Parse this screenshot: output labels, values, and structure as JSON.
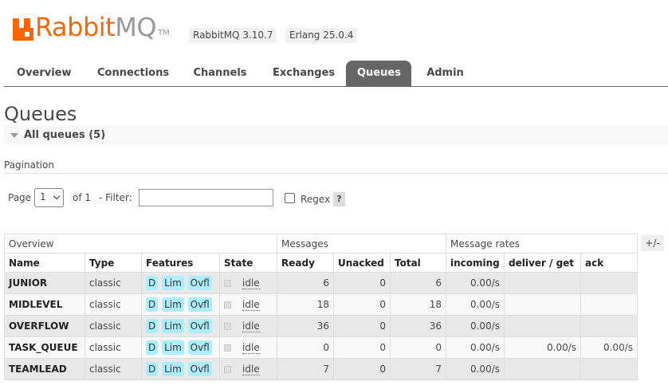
{
  "header": {
    "logo_rabbit": "Rabbit",
    "logo_mq": "MQ",
    "logo_tm": "TM",
    "version_rabbitmq": "RabbitMQ 3.10.7",
    "version_erlang": "Erlang 25.0.4",
    "brand_color": "#ff6600"
  },
  "tabs": [
    {
      "label": "Overview",
      "active": false
    },
    {
      "label": "Connections",
      "active": false
    },
    {
      "label": "Channels",
      "active": false
    },
    {
      "label": "Exchanges",
      "active": false
    },
    {
      "label": "Queues",
      "active": true
    },
    {
      "label": "Admin",
      "active": false
    }
  ],
  "page": {
    "title": "Queues",
    "section": "All queues (5)",
    "pagination_label": "Pagination",
    "page_label": "Page",
    "page_value": "1",
    "page_of": "of 1",
    "filter_label": "- Filter:",
    "filter_value": "",
    "regex_label": "Regex",
    "regex_checked": false,
    "help": "?",
    "plus_minus": "+/-"
  },
  "table": {
    "groups": [
      "Overview",
      "Messages",
      "Message rates"
    ],
    "columns": [
      "Name",
      "Type",
      "Features",
      "State",
      "Ready",
      "Unacked",
      "Total",
      "incoming",
      "deliver / get",
      "ack"
    ],
    "rows": [
      {
        "name": "JUNIOR",
        "type": "classic",
        "features": [
          "D",
          "Lim",
          "Ovfl"
        ],
        "state": "idle",
        "ready": "6",
        "unacked": "0",
        "total": "6",
        "incoming": "0.00/s",
        "deliver_get": "",
        "ack": ""
      },
      {
        "name": "MIDLEVEL",
        "type": "classic",
        "features": [
          "D",
          "Lim",
          "Ovfl"
        ],
        "state": "idle",
        "ready": "18",
        "unacked": "0",
        "total": "18",
        "incoming": "0.00/s",
        "deliver_get": "",
        "ack": ""
      },
      {
        "name": "OVERFLOW",
        "type": "classic",
        "features": [
          "D",
          "Lim",
          "Ovfl"
        ],
        "state": "idle",
        "ready": "36",
        "unacked": "0",
        "total": "36",
        "incoming": "0.00/s",
        "deliver_get": "",
        "ack": ""
      },
      {
        "name": "TASK_QUEUE",
        "type": "classic",
        "features": [
          "D",
          "Lim",
          "Ovfl"
        ],
        "state": "idle",
        "ready": "0",
        "unacked": "0",
        "total": "0",
        "incoming": "0.00/s",
        "deliver_get": "0.00/s",
        "ack": "0.00/s"
      },
      {
        "name": "TEAMLEAD",
        "type": "classic",
        "features": [
          "D",
          "Lim",
          "Ovfl"
        ],
        "state": "idle",
        "ready": "7",
        "unacked": "0",
        "total": "7",
        "incoming": "0.00/s",
        "deliver_get": "",
        "ack": ""
      }
    ]
  }
}
